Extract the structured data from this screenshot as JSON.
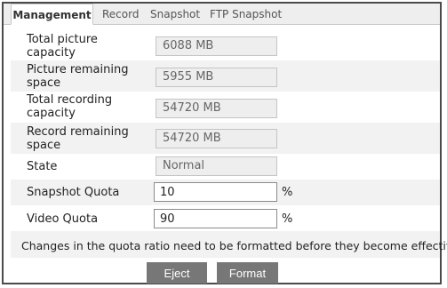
{
  "tabs": [
    {
      "label": "Management",
      "active": true
    },
    {
      "label": "Record",
      "active": false
    },
    {
      "label": "Snapshot",
      "active": false
    },
    {
      "label": "FTP Snapshot",
      "active": false
    }
  ],
  "fields": {
    "total_picture_capacity": {
      "label": "Total picture capacity",
      "value": "6088 MB"
    },
    "picture_remaining_space": {
      "label": "Picture remaining space",
      "value": "5955 MB"
    },
    "total_recording_capacity": {
      "label": "Total recording capacity",
      "value": "54720 MB"
    },
    "record_remaining_space": {
      "label": "Record remaining space",
      "value": "54720 MB"
    },
    "state": {
      "label": "State",
      "value": "Normal"
    },
    "snapshot_quota": {
      "label": "Snapshot Quota",
      "value": "10",
      "unit": "%"
    },
    "video_quota": {
      "label": "Video Quota",
      "value": "90",
      "unit": "%"
    }
  },
  "notice": "Changes in the quota ratio need to be formatted before they become effective.",
  "buttons": {
    "eject": "Eject",
    "format": "Format"
  },
  "colors": {
    "button_bg": "#777777",
    "tabbar_bg": "#eeeeee",
    "row_shade": "#f2f2f2"
  }
}
